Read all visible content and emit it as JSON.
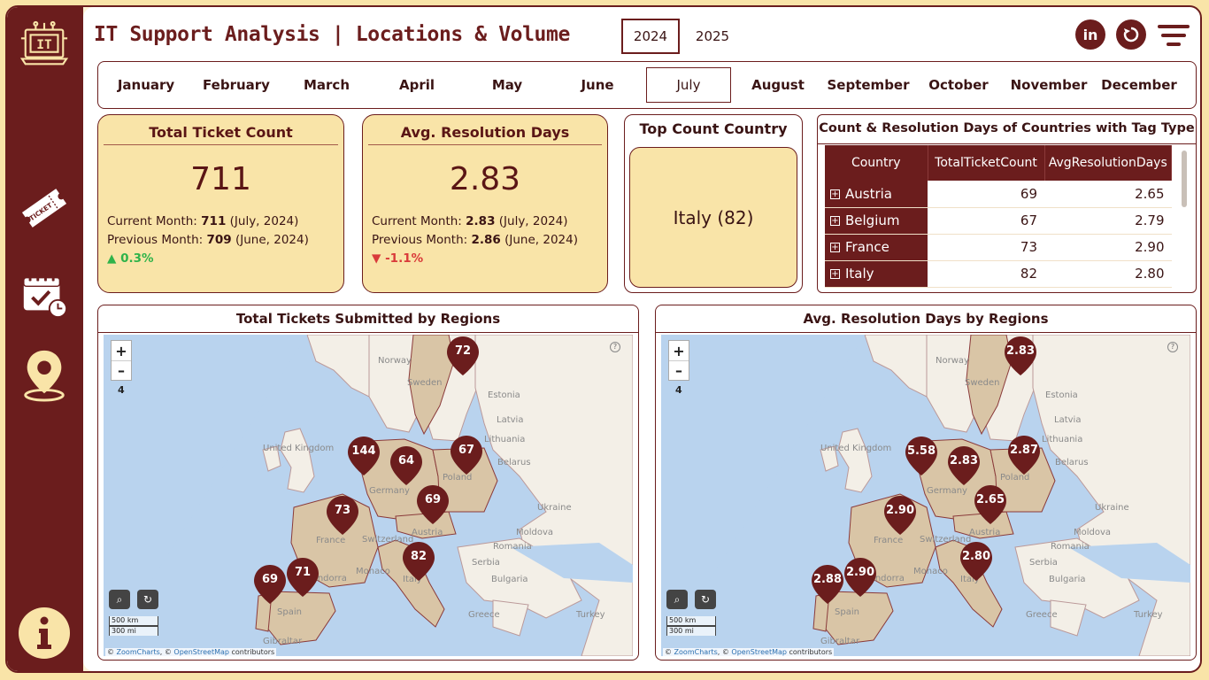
{
  "app": {
    "title": "IT Support Analysis | Locations & Volume"
  },
  "sidebar": {
    "logo_text": "IT",
    "ticket_text": "TICKET"
  },
  "years": [
    "2024",
    "2025"
  ],
  "selected_year": "2024",
  "months": [
    "January",
    "February",
    "March",
    "April",
    "May",
    "June",
    "July",
    "August",
    "September",
    "October",
    "November",
    "December"
  ],
  "selected_month": "July",
  "kpis": {
    "total_tickets": {
      "title": "Total Ticket Count",
      "value": "711",
      "current_label": "Current Month:",
      "current_value": "711",
      "current_period": "(July, 2024)",
      "previous_label": "Previous Month:",
      "previous_value": "709",
      "previous_period": "(June, 2024)",
      "change": "▲ 0.3%",
      "change_color": "#2fb34a"
    },
    "avg_resolution": {
      "title": "Avg. Resolution Days",
      "value": "2.83",
      "current_label": "Current Month:",
      "current_value": "2.83",
      "current_period": "(July, 2024)",
      "previous_label": "Previous Month:",
      "previous_value": "2.86",
      "previous_period": "(June, 2024)",
      "change": "▼ -1.1%",
      "change_color": "#d93a3a"
    }
  },
  "top_country": {
    "title": "Top Count Country",
    "value": "Italy (82)"
  },
  "country_table": {
    "title": "Count & Resolution Days of Countries with Tag Type",
    "headers": [
      "Country",
      "TotalTicketCount",
      "AvgResolutionDays"
    ],
    "rows": [
      {
        "country": "Austria",
        "count": "69",
        "avg": "2.65"
      },
      {
        "country": "Belgium",
        "count": "67",
        "avg": "2.79"
      },
      {
        "country": "France",
        "count": "73",
        "avg": "2.90"
      },
      {
        "country": "Italy",
        "count": "82",
        "avg": "2.80"
      }
    ]
  },
  "maps": [
    {
      "title": "Total Tickets Submitted by Regions",
      "zoom_level": "4",
      "pins": [
        {
          "id": "sweden",
          "value": "72"
        },
        {
          "id": "uk",
          "value": "144"
        },
        {
          "id": "germany",
          "value": "64"
        },
        {
          "id": "poland",
          "value": "67"
        },
        {
          "id": "austria",
          "value": "69"
        },
        {
          "id": "france",
          "value": "73"
        },
        {
          "id": "italy",
          "value": "82"
        },
        {
          "id": "spain",
          "value": "71"
        },
        {
          "id": "portugal",
          "value": "69"
        }
      ]
    },
    {
      "title": "Avg. Resolution Days by Regions",
      "zoom_level": "4",
      "pins": [
        {
          "id": "sweden",
          "value": "2.83"
        },
        {
          "id": "uk",
          "value": "5.58"
        },
        {
          "id": "germany",
          "value": "2.83"
        },
        {
          "id": "poland",
          "value": "2.87"
        },
        {
          "id": "austria",
          "value": "2.65"
        },
        {
          "id": "france",
          "value": "2.90"
        },
        {
          "id": "italy",
          "value": "2.80"
        },
        {
          "id": "spain",
          "value": "2.90"
        },
        {
          "id": "portugal",
          "value": "2.88"
        }
      ]
    }
  ],
  "map_labels": [
    "Norway",
    "Sweden",
    "Estonia",
    "Latvia",
    "Lithuania",
    "United Kingdom",
    "Belarus",
    "Germany",
    "Poland",
    "Ukraine",
    "Austria",
    "Moldova",
    "France",
    "Switzerland",
    "Romania",
    "Serbia",
    "Monaco",
    "Andorra",
    "Italy",
    "Bulgaria",
    "Spain",
    "Greece",
    "Turkey",
    "Gibraltar"
  ],
  "map_footer": {
    "scale_km": "500 km",
    "scale_mi": "300 mi",
    "attribution_prefix": "©",
    "attribution_zoomcharts": "ZoomCharts",
    "attribution_mid": ", ©",
    "attribution_osm": "OpenStreetMap",
    "attribution_suffix": "contributors"
  },
  "colors": {
    "primary": "#6b1d1d",
    "card": "#f9e4a8",
    "land": "#f3efe7",
    "sea": "#b9d3ee",
    "highlight": "#d9c5a6"
  }
}
